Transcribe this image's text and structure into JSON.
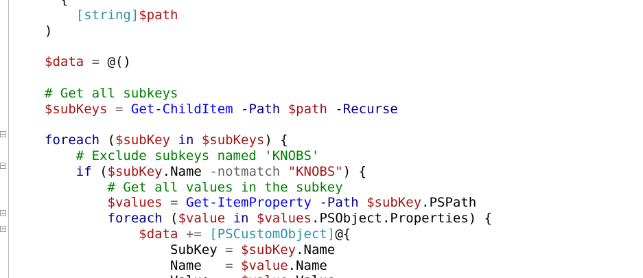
{
  "editor": {
    "lines": [
      [
        {
          "t": "txt",
          "v": "  {"
        }
      ],
      [
        {
          "t": "txt",
          "v": "    "
        },
        {
          "t": "type",
          "v": "[string]"
        },
        {
          "t": "var",
          "v": "$path"
        }
      ],
      [
        {
          "t": "txt",
          "v": ")"
        }
      ],
      [],
      [
        {
          "t": "var",
          "v": "$data"
        },
        {
          "t": "txt",
          "v": " "
        },
        {
          "t": "op",
          "v": "="
        },
        {
          "t": "txt",
          "v": " @()"
        }
      ],
      [],
      [
        {
          "t": "cmt",
          "v": "# Get all subkeys"
        }
      ],
      [
        {
          "t": "var",
          "v": "$subKeys"
        },
        {
          "t": "txt",
          "v": " "
        },
        {
          "t": "op",
          "v": "="
        },
        {
          "t": "txt",
          "v": " "
        },
        {
          "t": "cmd",
          "v": "Get-ChildItem"
        },
        {
          "t": "txt",
          "v": " "
        },
        {
          "t": "kw",
          "v": "-Path"
        },
        {
          "t": "txt",
          "v": " "
        },
        {
          "t": "var",
          "v": "$path"
        },
        {
          "t": "txt",
          "v": " "
        },
        {
          "t": "kw",
          "v": "-Recurse"
        }
      ],
      [],
      [
        {
          "t": "kw",
          "v": "foreach"
        },
        {
          "t": "txt",
          "v": " ("
        },
        {
          "t": "var",
          "v": "$subKey"
        },
        {
          "t": "txt",
          "v": " "
        },
        {
          "t": "kw",
          "v": "in"
        },
        {
          "t": "txt",
          "v": " "
        },
        {
          "t": "var",
          "v": "$subKeys"
        },
        {
          "t": "txt",
          "v": ") {"
        }
      ],
      [
        {
          "t": "txt",
          "v": "    "
        },
        {
          "t": "cmt",
          "v": "# Exclude subkeys named 'KNOBS'"
        }
      ],
      [
        {
          "t": "txt",
          "v": "    "
        },
        {
          "t": "kw",
          "v": "if"
        },
        {
          "t": "txt",
          "v": " ("
        },
        {
          "t": "var",
          "v": "$subKey"
        },
        {
          "t": "txt",
          "v": ".Name "
        },
        {
          "t": "op",
          "v": "-notmatch"
        },
        {
          "t": "txt",
          "v": " "
        },
        {
          "t": "str",
          "v": "\"KNOBS\""
        },
        {
          "t": "txt",
          "v": ") {"
        }
      ],
      [
        {
          "t": "txt",
          "v": "        "
        },
        {
          "t": "cmt",
          "v": "# Get all values in the subkey"
        }
      ],
      [
        {
          "t": "txt",
          "v": "        "
        },
        {
          "t": "var",
          "v": "$values"
        },
        {
          "t": "txt",
          "v": " "
        },
        {
          "t": "op",
          "v": "="
        },
        {
          "t": "txt",
          "v": " "
        },
        {
          "t": "cmd",
          "v": "Get-ItemProperty"
        },
        {
          "t": "txt",
          "v": " "
        },
        {
          "t": "kw",
          "v": "-Path"
        },
        {
          "t": "txt",
          "v": " "
        },
        {
          "t": "var",
          "v": "$subKey"
        },
        {
          "t": "txt",
          "v": ".PSPath"
        }
      ],
      [
        {
          "t": "txt",
          "v": "        "
        },
        {
          "t": "kw",
          "v": "foreach"
        },
        {
          "t": "txt",
          "v": " ("
        },
        {
          "t": "var",
          "v": "$value"
        },
        {
          "t": "txt",
          "v": " "
        },
        {
          "t": "kw",
          "v": "in"
        },
        {
          "t": "txt",
          "v": " "
        },
        {
          "t": "var",
          "v": "$values"
        },
        {
          "t": "txt",
          "v": ".PSObject.Properties) {"
        }
      ],
      [
        {
          "t": "txt",
          "v": "            "
        },
        {
          "t": "var",
          "v": "$data"
        },
        {
          "t": "txt",
          "v": " "
        },
        {
          "t": "op",
          "v": "+="
        },
        {
          "t": "txt",
          "v": " "
        },
        {
          "t": "type",
          "v": "[PSCustomObject]"
        },
        {
          "t": "txt",
          "v": "@{"
        }
      ],
      [
        {
          "t": "txt",
          "v": "                SubKey "
        },
        {
          "t": "op",
          "v": "="
        },
        {
          "t": "txt",
          "v": " "
        },
        {
          "t": "var",
          "v": "$subKey"
        },
        {
          "t": "txt",
          "v": ".Name"
        }
      ],
      [
        {
          "t": "txt",
          "v": "                Name   "
        },
        {
          "t": "op",
          "v": "="
        },
        {
          "t": "txt",
          "v": " "
        },
        {
          "t": "var",
          "v": "$value"
        },
        {
          "t": "txt",
          "v": ".Name"
        }
      ],
      [
        {
          "t": "txt",
          "v": "                Value  "
        },
        {
          "t": "op",
          "v": "="
        },
        {
          "t": "txt",
          "v": " "
        },
        {
          "t": "var",
          "v": "$value"
        },
        {
          "t": "txt",
          "v": ".Value"
        }
      ]
    ]
  }
}
